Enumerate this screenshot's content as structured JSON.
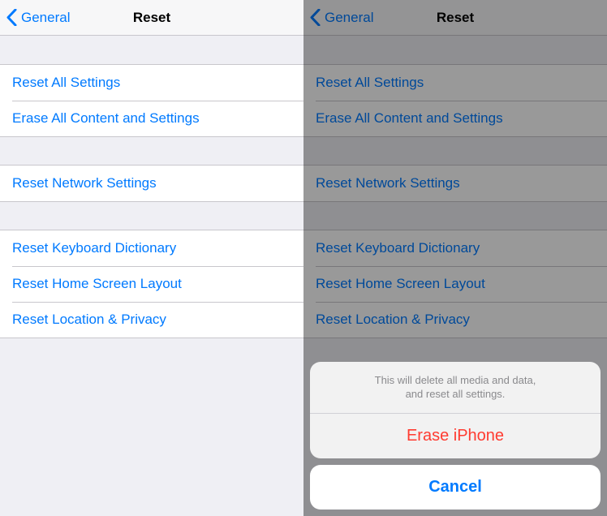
{
  "nav": {
    "back": "General",
    "title": "Reset"
  },
  "group1": {
    "reset_all": "Reset All Settings",
    "erase_all": "Erase All Content and Settings"
  },
  "group2": {
    "reset_network": "Reset Network Settings"
  },
  "group3": {
    "reset_keyboard": "Reset Keyboard Dictionary",
    "reset_home": "Reset Home Screen Layout",
    "reset_location": "Reset Location & Privacy"
  },
  "sheet": {
    "message_line1": "This will delete all media and data,",
    "message_line2": "and reset all settings.",
    "erase": "Erase iPhone",
    "cancel": "Cancel"
  }
}
